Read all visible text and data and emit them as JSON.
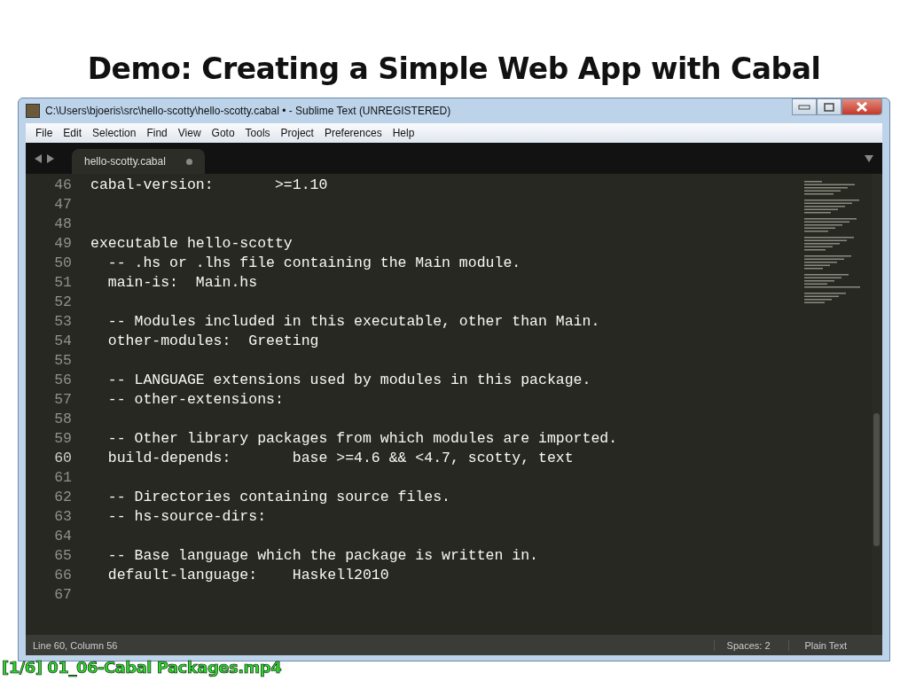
{
  "slide_title": "Demo: Creating a Simple Web App with Cabal",
  "window": {
    "title": "C:\\Users\\bjoeris\\src\\hello-scotty\\hello-scotty.cabal • - Sublime Text (UNREGISTERED)",
    "menu": [
      "File",
      "Edit",
      "Selection",
      "Find",
      "View",
      "Goto",
      "Tools",
      "Project",
      "Preferences",
      "Help"
    ],
    "tabs": [
      {
        "label": "hello-scotty.cabal",
        "selected": true,
        "modified": true
      }
    ],
    "lines": [
      {
        "number": "46",
        "text": "cabal-version:       >=1.10",
        "current": false
      },
      {
        "number": "47",
        "current": false
      },
      {
        "number": "48",
        "current": false
      },
      {
        "number": "49",
        "text": "executable hello-scotty",
        "current": false
      },
      {
        "number": "50",
        "text": "  -- .hs or .lhs file containing the Main module.",
        "current": false
      },
      {
        "number": "51",
        "text": "  main-is:  Main.hs",
        "current": false
      },
      {
        "number": "52",
        "current": false
      },
      {
        "number": "53",
        "text": "  -- Modules included in this executable, other than Main.",
        "current": false
      },
      {
        "number": "54",
        "text": "  other-modules:  Greeting",
        "current": false
      },
      {
        "number": "55",
        "current": false
      },
      {
        "number": "56",
        "text": "  -- LANGUAGE extensions used by modules in this package.",
        "current": false
      },
      {
        "number": "57",
        "text": "  -- other-extensions:",
        "current": false
      },
      {
        "number": "58",
        "current": false
      },
      {
        "number": "59",
        "text": "  -- Other library packages from which modules are imported.",
        "current": false
      },
      {
        "number": "60",
        "text": "  build-depends:       base >=4.6 && <4.7, scotty, text",
        "current": true
      },
      {
        "number": "61",
        "current": false
      },
      {
        "number": "62",
        "text": "  -- Directories containing source files.",
        "current": false
      },
      {
        "number": "63",
        "text": "  -- hs-source-dirs:",
        "current": false
      },
      {
        "number": "64",
        "current": false
      },
      {
        "number": "65",
        "text": "  -- Base language which the package is written in.",
        "current": false
      },
      {
        "number": "66",
        "text": "  default-language:    Haskell2010",
        "current": false
      },
      {
        "number": "67",
        "current": false
      }
    ],
    "status": {
      "position": "Line 60, Column 56",
      "spaces": "Spaces: 2",
      "syntax": "Plain Text"
    }
  },
  "caption": "[1/6] 01_06-Cabal Packages.mp4"
}
